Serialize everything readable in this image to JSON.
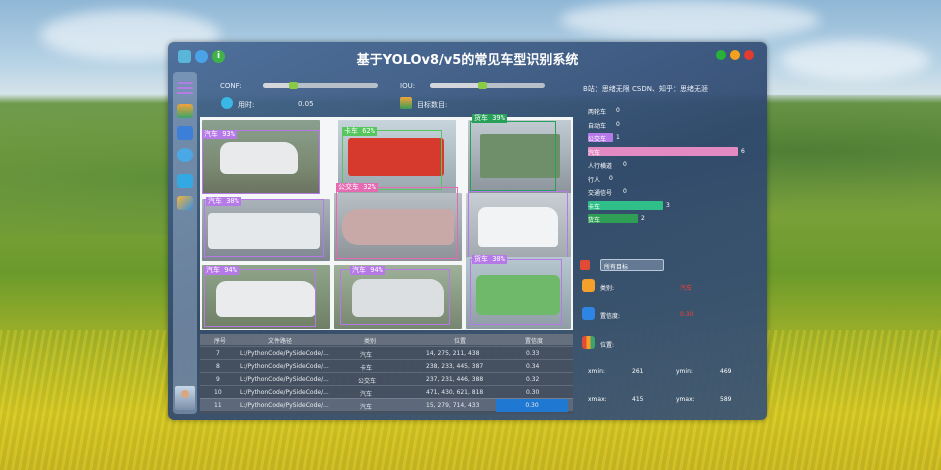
{
  "window": {
    "title": "基于YOLOv8/v5的常见车型识别系统",
    "author": "B站：思绪无限  CSDN、知乎：思绪无涯"
  },
  "controls": {
    "conf_label": "CONF:",
    "iou_label": "IOU:",
    "time_label": "用时:",
    "time_value": "0.05",
    "target_label": "目标数目:",
    "conf_value": 0.25,
    "iou_value": 0.45
  },
  "detections": [
    {
      "label": "汽车 93%",
      "color": "#b67ae8"
    },
    {
      "label": "卡车 62%",
      "color": "#56c75d"
    },
    {
      "label": "货车 39%",
      "color": "#27a05a"
    },
    {
      "label": "公交车 32%",
      "color": "#e46ab1"
    },
    {
      "label": "汽车 30%",
      "color": "#b67ae8"
    },
    {
      "label": "汽车 94%",
      "color": "#b67ae8"
    },
    {
      "label": "汽车 94%",
      "color": "#b67ae8"
    },
    {
      "label": "货车 30%",
      "color": "#b67ae8"
    }
  ],
  "table": {
    "headers": [
      "序号",
      "文件路径",
      "类别",
      "位置",
      "置信度"
    ],
    "rows": [
      {
        "id": "7",
        "path": "L:/PythonCode/PySideCode/...",
        "cls": "汽车",
        "pos": "14, 275, 211, 438",
        "conf": "0.33"
      },
      {
        "id": "8",
        "path": "L:/PythonCode/PySideCode/...",
        "cls": "卡车",
        "pos": "238, 233, 445, 387",
        "conf": "0.34"
      },
      {
        "id": "9",
        "path": "L:/PythonCode/PySideCode/...",
        "cls": "公交车",
        "pos": "237, 231, 446, 388",
        "conf": "0.32"
      },
      {
        "id": "10",
        "path": "L:/PythonCode/PySideCode/...",
        "cls": "汽车",
        "pos": "471, 430, 621, 818",
        "conf": "0.30"
      },
      {
        "id": "11",
        "path": "L:/PythonCode/PySideCode/...",
        "cls": "汽车",
        "pos": "15, 279, 714, 433",
        "conf": "0.30"
      }
    ]
  },
  "stats": [
    {
      "name": "两轮车",
      "value": 0,
      "color": "#b67ae8"
    },
    {
      "name": "自动车",
      "value": 0,
      "color": "#b67ae8"
    },
    {
      "name": "公交车",
      "value": 1,
      "color": "#b67ae8"
    },
    {
      "name": "汽车",
      "value": 6,
      "color": "#e48ac3"
    },
    {
      "name": "人行横道",
      "value": 0,
      "color": "#b67ae8"
    },
    {
      "name": "行人",
      "value": 0,
      "color": "#b67ae8"
    },
    {
      "name": "交通信号",
      "value": 0,
      "color": "#b67ae8"
    },
    {
      "name": "卡车",
      "value": 3,
      "color": "#2fbf88"
    },
    {
      "name": "货车",
      "value": 2,
      "color": "#2f9f55"
    }
  ],
  "detail": {
    "select_label": "所有目标",
    "class_label": "类别:",
    "class_value": "汽车",
    "conf_label": "置信度:",
    "conf_value": "0.30",
    "pos_label": "位置:",
    "xmin_label": "xmin:",
    "xmin_value": "261",
    "ymin_label": "ymin:",
    "ymin_value": "469",
    "xmax_label": "xmax:",
    "xmax_value": "415",
    "ymax_label": "ymax:",
    "ymax_value": "589"
  }
}
